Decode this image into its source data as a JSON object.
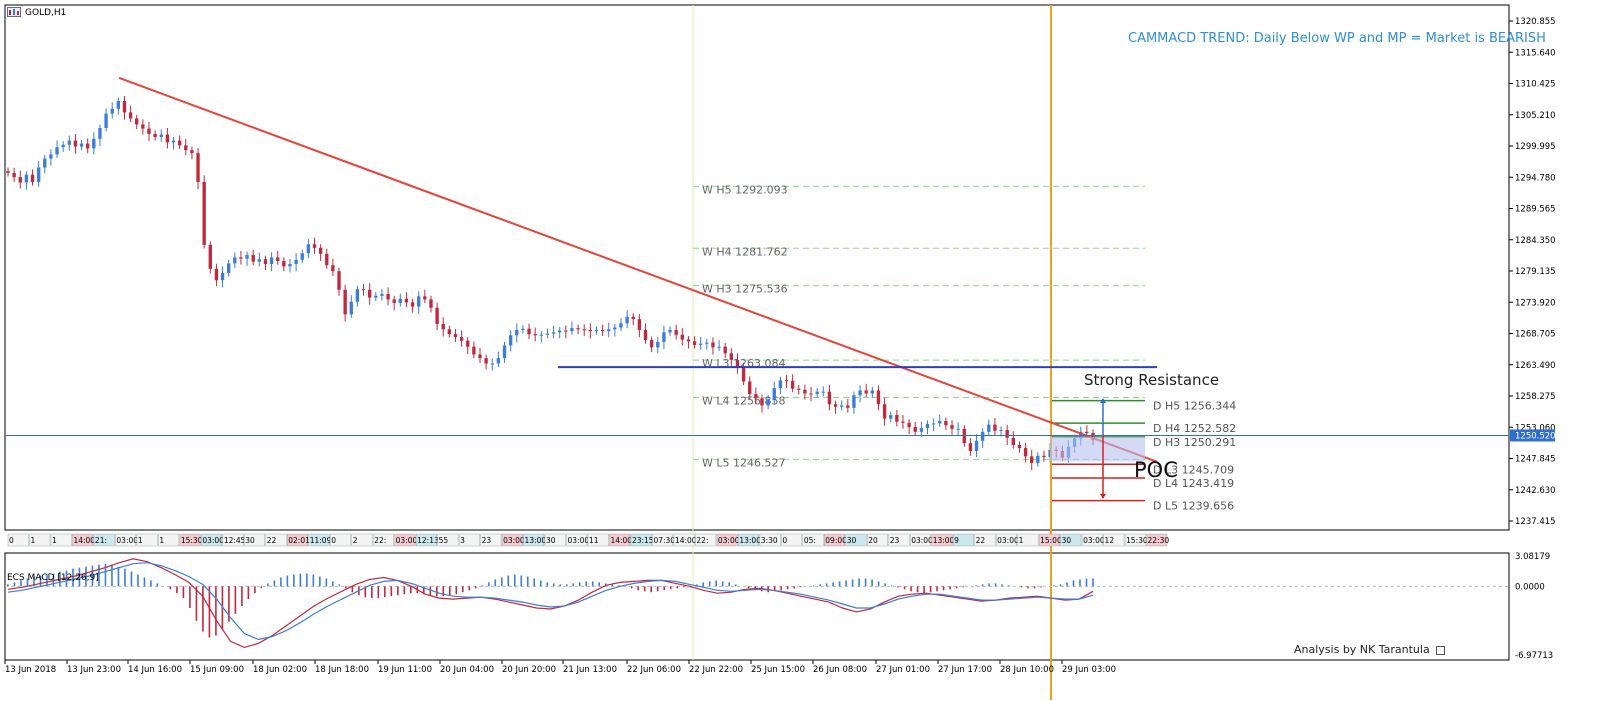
{
  "header": {
    "symbol": "GOLD,H1",
    "trend_note": "CAMMACD TREND: Daily Below WP and MP = Market is BEARISH",
    "strong_resistance": "Strong Resistance",
    "poc": "POC",
    "credit": "Analysis by NK Tarantula"
  },
  "colors": {
    "bull": "#3b7dd8",
    "bear": "#c1283e",
    "trendline": "#e8423a",
    "resistance": "#2b3fbf",
    "vertical_marker": "#f0a020",
    "price_line": "#2f6fd0",
    "weekly_level": "#8fd88f",
    "daily_h": "#2e8b2e",
    "daily_l": "#d42020",
    "macd_line": "#c1283e",
    "signal_line": "#3b7dd8"
  },
  "chart_data": {
    "type": "candlestick",
    "symbol": "GOLD",
    "timeframe": "H1",
    "ylim": [
      1234.8,
      1322.5
    ],
    "y_ticks": [
      "1320.855",
      "1315.640",
      "1310.425",
      "1305.210",
      "1299.995",
      "1294.780",
      "1289.565",
      "1284.350",
      "1279.135",
      "1273.920",
      "1268.705",
      "1263.490",
      "1258.275",
      "1253.060",
      "1247.845",
      "1242.630",
      "1237.415"
    ],
    "current_price": "1250.520",
    "x_labels": [
      "13 Jun 2018",
      "13 Jun 23:00",
      "14 Jun 16:00",
      "15 Jun 09:00",
      "18 Jun 02:00",
      "18 Jun 18:00",
      "19 Jun 11:00",
      "20 Jun 04:00",
      "20 Jun 20:00",
      "21 Jun 13:00",
      "22 Jun 06:00",
      "22 Jun 22:00",
      "25 Jun 15:00",
      "26 Jun 08:00",
      "27 Jun 01:00",
      "27 Jun 17:00",
      "28 Jun 10:00",
      "29 Jun 03:00"
    ],
    "session_strip": [
      "0",
      "1",
      "1",
      "14:00",
      "21:",
      "03:00",
      "1",
      "1",
      "15:30",
      "03:00",
      "12:45",
      "30",
      "22",
      "02:01",
      "11:09",
      "0",
      "2",
      "22:",
      "03:00",
      "12:13",
      "55",
      "3",
      "23",
      "03:00",
      "13:00",
      "30",
      "03:00",
      "11",
      "14:00",
      "23:15",
      "07:30",
      "14:00",
      "22:",
      "03:00",
      "13:00",
      "3:30",
      "0",
      "05:",
      "09:00",
      "30",
      "20",
      "23",
      "03:00",
      "13:00",
      "9",
      "22",
      "03:00",
      "1",
      "15:00",
      "30",
      "03:00",
      "12",
      "15:30",
      "22:30"
    ],
    "close_path": [
      1295.5,
      1294.8,
      1293.9,
      1295.2,
      1294.0,
      1296.4,
      1297.9,
      1298.6,
      1299.8,
      1300.2,
      1300.9,
      1299.9,
      1300.4,
      1299.6,
      1301.2,
      1303.0,
      1305.4,
      1306.2,
      1307.5,
      1305.6,
      1304.6,
      1303.6,
      1302.9,
      1302.0,
      1301.5,
      1301.9,
      1300.6,
      1300.9,
      1300.1,
      1299.3,
      1298.8,
      1294.0,
      1283.5,
      1279.5,
      1277.6,
      1278.8,
      1280.4,
      1281.4,
      1281.2,
      1281.8,
      1280.7,
      1281.1,
      1280.3,
      1281.4,
      1280.8,
      1279.9,
      1280.3,
      1281.0,
      1282.1,
      1283.6,
      1283.0,
      1282.0,
      1280.1,
      1279.1,
      1276.0,
      1271.9,
      1274.0,
      1276.1,
      1276.0,
      1274.7,
      1275.0,
      1275.3,
      1274.4,
      1273.8,
      1274.5,
      1273.9,
      1273.2,
      1274.9,
      1274.4,
      1273.0,
      1270.3,
      1269.4,
      1268.6,
      1268.1,
      1267.5,
      1266.5,
      1265.2,
      1264.6,
      1263.7,
      1263.7,
      1264.6,
      1266.7,
      1268.4,
      1269.3,
      1269.5,
      1268.6,
      1268.4,
      1268.5,
      1268.7,
      1268.9,
      1269.2,
      1269.1,
      1269.6,
      1269.4,
      1269.3,
      1269.1,
      1269.3,
      1269.1,
      1269.4,
      1269.7,
      1270.4,
      1271.5,
      1271.1,
      1269.3,
      1267.6,
      1266.4,
      1267.3,
      1268.9,
      1269.3,
      1268.5,
      1267.7,
      1267.4,
      1266.8,
      1267.0,
      1267.2,
      1266.4,
      1266.5,
      1265.4,
      1264.3,
      1263.2,
      1260.7,
      1258.6,
      1257.9,
      1256.7,
      1257.6,
      1259.6,
      1260.9,
      1260.8,
      1259.5,
      1259.3,
      1258.7,
      1258.6,
      1259.0,
      1259.0,
      1256.9,
      1256.5,
      1256.7,
      1256.3,
      1258.4,
      1259.2,
      1258.7,
      1259.2,
      1256.9,
      1254.5,
      1255.1,
      1254.0,
      1253.8,
      1253.1,
      1252.3,
      1252.9,
      1253.6,
      1253.7,
      1254.1,
      1253.4,
      1252.8,
      1252.8,
      1250.4,
      1249.1,
      1250.8,
      1252.3,
      1253.5,
      1252.5,
      1252.6,
      1251.3,
      1250.1,
      1249.6,
      1248.2,
      1247.1,
      1248.3,
      1248.1,
      1249.3,
      1249.1,
      1248.0,
      1249.8,
      1251.2,
      1252.3,
      1252.1,
      1250.9
    ],
    "trendline": {
      "from": {
        "x_label": "13 Jun 23:00",
        "price": 1310.2
      },
      "to": {
        "x_label": "29 Jun 03:00",
        "price": 1247.8
      }
    },
    "strong_resistance_level": 1262.1,
    "poc_zone": [
      1246.2,
      1250.3
    ],
    "projection_up_to": 1256.6,
    "projection_down_to": 1240.1,
    "weekly_levels": [
      {
        "label": "W  H5 1292.093",
        "price": 1292.093
      },
      {
        "label": "W  H4 1281.762",
        "price": 1281.762
      },
      {
        "label": "W  H3 1275.536",
        "price": 1275.536
      },
      {
        "label": "W  L3 1263.084",
        "price": 1263.084
      },
      {
        "label": "W  L4 1256.858",
        "price": 1256.858
      },
      {
        "label": "W  L5 1246.527",
        "price": 1246.527
      }
    ],
    "daily_levels": [
      {
        "label": "D  H5 1256.344",
        "price": 1256.344,
        "kind": "H"
      },
      {
        "label": "D  H4 1252.582",
        "price": 1252.582,
        "kind": "H"
      },
      {
        "label": "D  H3 1250.291",
        "price": 1250.291,
        "kind": "H"
      },
      {
        "label": "D  L3 1245.709",
        "price": 1245.709,
        "kind": "L"
      },
      {
        "label": "D  L4 1243.419",
        "price": 1243.419,
        "kind": "L"
      },
      {
        "label": "D  L5 1239.656",
        "price": 1239.656,
        "kind": "L"
      }
    ],
    "macd": {
      "label": "ECS MACD [12,26,9]",
      "ylim": [
        -6.97713,
        3.08179
      ],
      "y_ticks": [
        "3.08179",
        "0.0000",
        "-6.97713"
      ],
      "histogram": [
        0.2,
        0.4,
        0.6,
        0.8,
        1.0,
        1.1,
        1.2,
        1.3,
        1.5,
        1.6,
        1.8,
        1.9,
        2.0,
        2.1,
        2.2,
        2.3,
        2.2,
        2.0,
        1.8,
        1.5,
        1.2,
        0.9,
        0.6,
        0.3,
        0.0,
        -0.3,
        -0.7,
        -1.2,
        -2.2,
        -3.5,
        -4.6,
        -5.2,
        -5.0,
        -4.4,
        -3.6,
        -2.8,
        -2.0,
        -1.3,
        -0.7,
        -0.2,
        0.3,
        0.6,
        0.9,
        1.1,
        1.2,
        1.3,
        1.3,
        1.2,
        1.0,
        0.8,
        0.5,
        0.2,
        -0.2,
        -0.6,
        -0.9,
        -1.1,
        -1.2,
        -1.2,
        -1.1,
        -1.0,
        -0.9,
        -0.8,
        -0.7,
        -0.7,
        -0.8,
        -0.9,
        -1.0,
        -1.0,
        -0.9,
        -0.8,
        -0.6,
        -0.4,
        -0.2,
        0.1,
        0.4,
        0.7,
        0.9,
        1.1,
        1.2,
        1.1,
        1.0,
        0.8,
        0.6,
        0.4,
        0.3,
        0.2,
        0.2,
        0.3,
        0.4,
        0.5,
        0.5,
        0.4,
        0.3,
        0.2,
        0.1,
        0.0,
        -0.2,
        -0.4,
        -0.5,
        -0.6,
        -0.5,
        -0.4,
        -0.3,
        -0.2,
        -0.1,
        0.0,
        0.2,
        0.4,
        0.5,
        0.6,
        0.5,
        0.4,
        0.2,
        0.0,
        -0.2,
        -0.4,
        -0.5,
        -0.6,
        -0.5,
        -0.4,
        -0.3,
        -0.2,
        -0.1,
        0.0,
        0.1,
        0.2,
        0.3,
        0.4,
        0.5,
        0.6,
        0.7,
        0.8,
        0.8,
        0.7,
        0.5,
        0.3,
        0.1,
        -0.1,
        -0.3,
        -0.5,
        -0.6,
        -0.7,
        -0.6,
        -0.5,
        -0.4,
        -0.3,
        -0.2,
        -0.1,
        0.0,
        0.1,
        0.2,
        0.3,
        0.3,
        0.2,
        0.1,
        0.0,
        -0.1,
        -0.2,
        -0.2,
        -0.1,
        0.0,
        0.1,
        0.2,
        0.4,
        0.6,
        0.7,
        0.8,
        0.8
      ],
      "macd_line": [
        -0.3,
        -0.1,
        0.2,
        0.5,
        0.8,
        1.1,
        1.5,
        1.9,
        2.4,
        2.8,
        2.5,
        1.9,
        1.2,
        0.4,
        -1.0,
        -3.5,
        -5.6,
        -6.2,
        -5.8,
        -5.0,
        -4.0,
        -3.0,
        -2.0,
        -1.2,
        -0.5,
        0.2,
        0.7,
        0.9,
        0.6,
        0.0,
        -0.8,
        -1.2,
        -1.3,
        -1.2,
        -1.1,
        -1.3,
        -1.6,
        -1.9,
        -2.2,
        -2.3,
        -2.0,
        -1.4,
        -0.6,
        0.1,
        0.4,
        0.5,
        0.6,
        0.6,
        0.3,
        0.0,
        -0.4,
        -0.7,
        -0.6,
        -0.3,
        -0.2,
        -0.4,
        -0.7,
        -1.0,
        -1.3,
        -1.6,
        -2.2,
        -2.6,
        -2.3,
        -1.6,
        -1.0,
        -0.8,
        -0.7,
        -0.9,
        -1.1,
        -1.3,
        -1.5,
        -1.4,
        -1.2,
        -1.1,
        -1.0,
        -1.2,
        -1.4,
        -1.3,
        -0.5
      ],
      "signal_line": [
        -0.6,
        -0.4,
        -0.1,
        0.2,
        0.5,
        0.8,
        1.1,
        1.5,
        1.9,
        2.3,
        2.4,
        2.1,
        1.6,
        1.0,
        0.2,
        -1.3,
        -3.2,
        -4.8,
        -5.4,
        -5.1,
        -4.5,
        -3.7,
        -2.8,
        -2.0,
        -1.3,
        -0.6,
        0.1,
        0.5,
        0.6,
        0.3,
        -0.2,
        -0.7,
        -1.0,
        -1.1,
        -1.1,
        -1.2,
        -1.4,
        -1.6,
        -1.9,
        -2.1,
        -2.0,
        -1.6,
        -1.0,
        -0.4,
        0.0,
        0.3,
        0.5,
        0.6,
        0.5,
        0.2,
        -0.1,
        -0.4,
        -0.5,
        -0.4,
        -0.3,
        -0.4,
        -0.6,
        -0.8,
        -1.1,
        -1.4,
        -1.8,
        -2.2,
        -2.2,
        -1.8,
        -1.3,
        -1.0,
        -0.8,
        -0.8,
        -1.0,
        -1.2,
        -1.4,
        -1.4,
        -1.3,
        -1.2,
        -1.1,
        -1.2,
        -1.3,
        -1.3,
        -0.9
      ]
    }
  }
}
